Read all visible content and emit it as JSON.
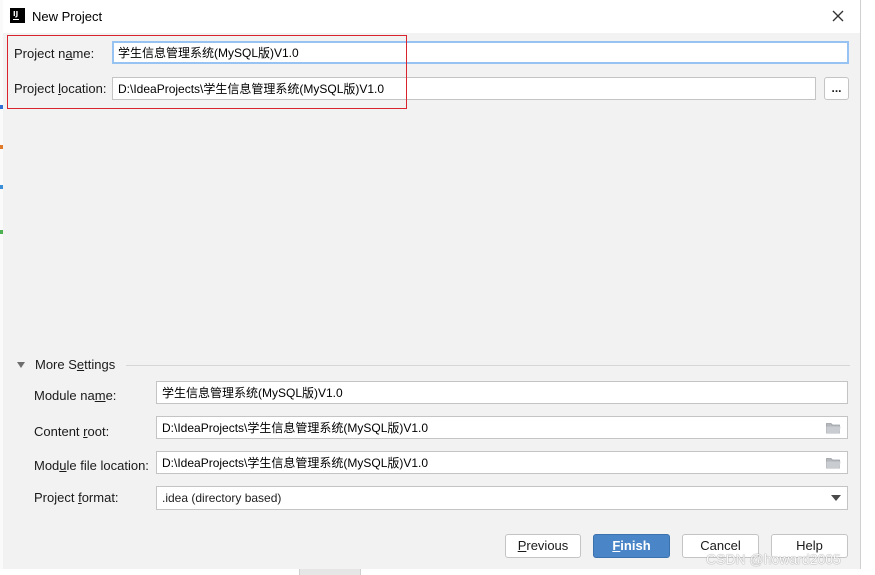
{
  "window": {
    "title": "New Project"
  },
  "project": {
    "name_label": "Project name:",
    "name_value": "学生信息管理系统(MySQL版)V1.0",
    "location_label": "Project location:",
    "location_value": "D:\\IdeaProjects\\学生信息管理系统(MySQL版)V1.0",
    "browse_label": "..."
  },
  "more_settings": {
    "label": "More Settings",
    "expanded": true,
    "module_name_label": "Module name:",
    "module_name_value": "学生信息管理系统(MySQL版)V1.0",
    "content_root_label": "Content root:",
    "content_root_value": "D:\\IdeaProjects\\学生信息管理系统(MySQL版)V1.0",
    "module_file_location_label": "Module file location:",
    "module_file_location_value": "D:\\IdeaProjects\\学生信息管理系统(MySQL版)V1.0",
    "project_format_label": "Project format:",
    "project_format_value": ".idea (directory based)"
  },
  "buttons": {
    "previous": "Previous",
    "finish": "Finish",
    "cancel": "Cancel",
    "help": "Help"
  },
  "watermark": "CSDN @howard2005",
  "colors": {
    "accent": "#4a86c7",
    "focus_border": "#97c3f3",
    "highlight_red": "#d9232d",
    "dialog_bg": "#f2f2f2"
  },
  "icons": {
    "app": "intellij-idea-icon",
    "close": "close-icon",
    "expand": "triangle-down-icon",
    "folder": "folder-icon",
    "dropdown": "dropdown-arrow-icon"
  }
}
